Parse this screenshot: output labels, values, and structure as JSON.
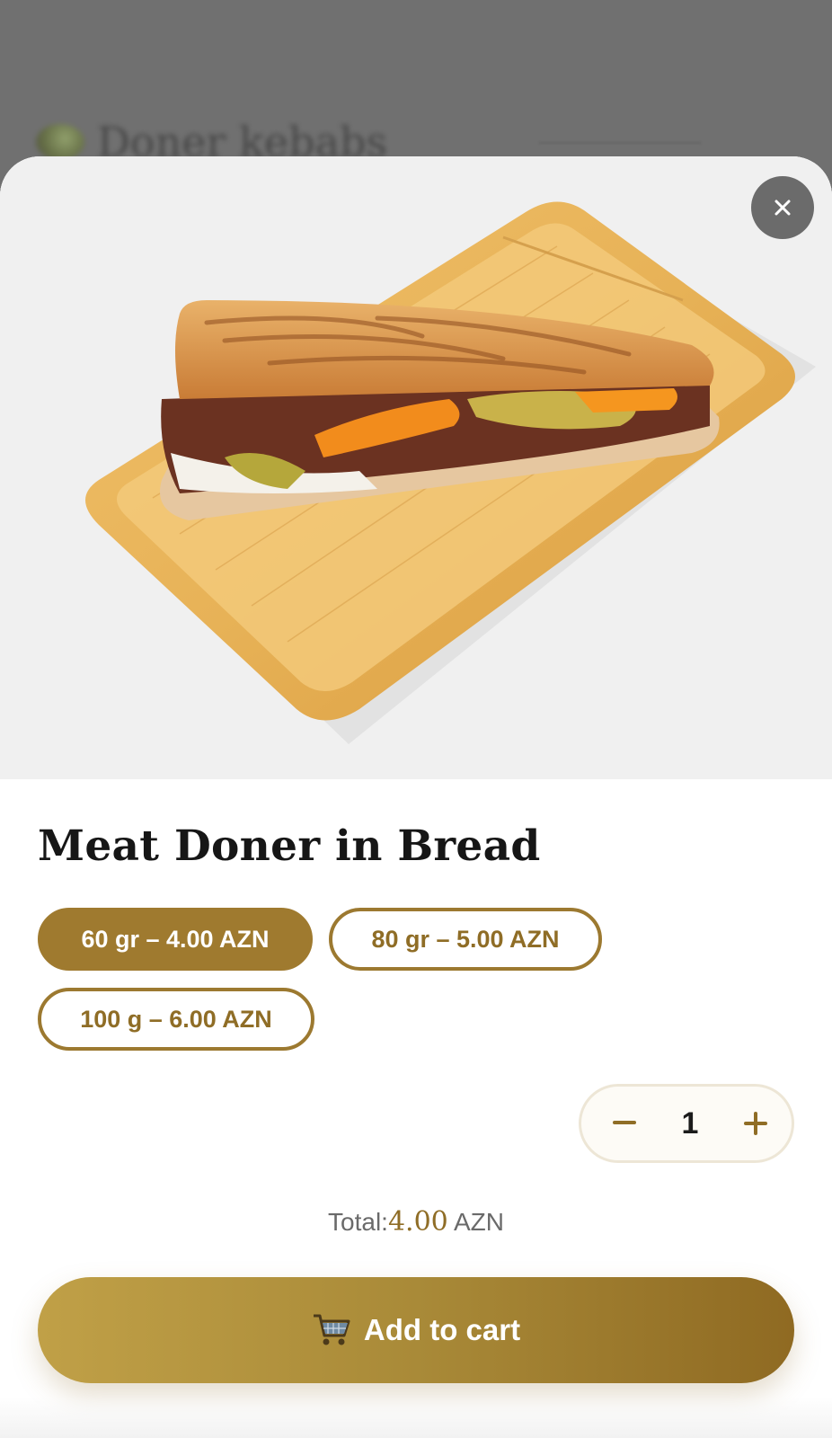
{
  "background": {
    "title": "Doner kebabs"
  },
  "modal": {
    "product_title": "Meat Doner in Bread",
    "close_icon": "close-icon",
    "options": [
      {
        "label": "60 gr – 4.00 AZN",
        "selected": true
      },
      {
        "label": "80 gr – 5.00 AZN",
        "selected": false
      },
      {
        "label": "100 g – 6.00 AZN",
        "selected": false
      }
    ],
    "quantity": {
      "value": "1",
      "minus_icon": "minus-icon",
      "plus_icon": "plus-icon"
    },
    "total": {
      "label": "Total:",
      "amount": "4.00",
      "currency": "AZN"
    },
    "add_to_cart": {
      "icon": "cart-icon",
      "label": "Add to cart"
    }
  },
  "colors": {
    "accent": "#9f7a2f",
    "button_gradient_start": "#c0a047",
    "button_gradient_end": "#8f6a22",
    "overlay": "#707070"
  }
}
